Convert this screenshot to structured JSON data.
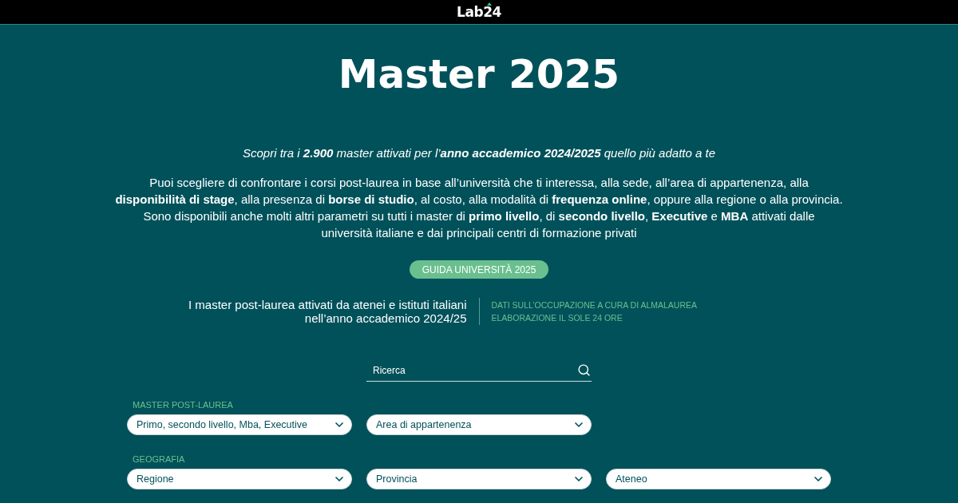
{
  "header": {
    "logo": "Lab24"
  },
  "hero": {
    "title": "Master 2025",
    "subtitle": "Scopri tra i **2.900** master attivati per l’**anno accademico 2024/2025** quello più adatto a te",
    "description": [
      "Puoi scegliere di confrontare i corsi post-laurea in base all’università che ti interessa, alla sede, all’area di appartenenza, alla **disponibilità di stage**, alla presenza di **borse di studio**, al costo, alla modalità di **frequenza online**, oppure alla regione o alla provincia.",
      "Sono disponibili anche molti altri parametri su tutti i master di **primo livello**, di **secondo livello**, **Executive** e **MBA** attivati dalle università italiane e dai principali centri di formazione privati"
    ],
    "button": "GUIDA UNIVERSITÀ 2025"
  },
  "info": {
    "lines": [
      "I master post-laurea attivati da atenei e istituti italiani",
      "nell’anno accademico 2024/25"
    ],
    "credits": [
      "DATI SULL’OCCUPAZIONE A CURA DI ALMALAUREA",
      "ELABORAZIONE IL SOLE 24 ORE"
    ]
  },
  "search": {
    "placeholder": "Ricerca"
  },
  "filters": [
    {
      "label": "MASTER POST-LAUREA",
      "selects": [
        {
          "value": "Primo, secondo livello, Mba, Executive"
        },
        {
          "value": "Area di appartenenza"
        }
      ]
    },
    {
      "label": "GEOGRAFIA",
      "selects": [
        {
          "value": "Regione"
        },
        {
          "value": "Provincia"
        },
        {
          "value": "Ateneo"
        }
      ]
    }
  ]
}
